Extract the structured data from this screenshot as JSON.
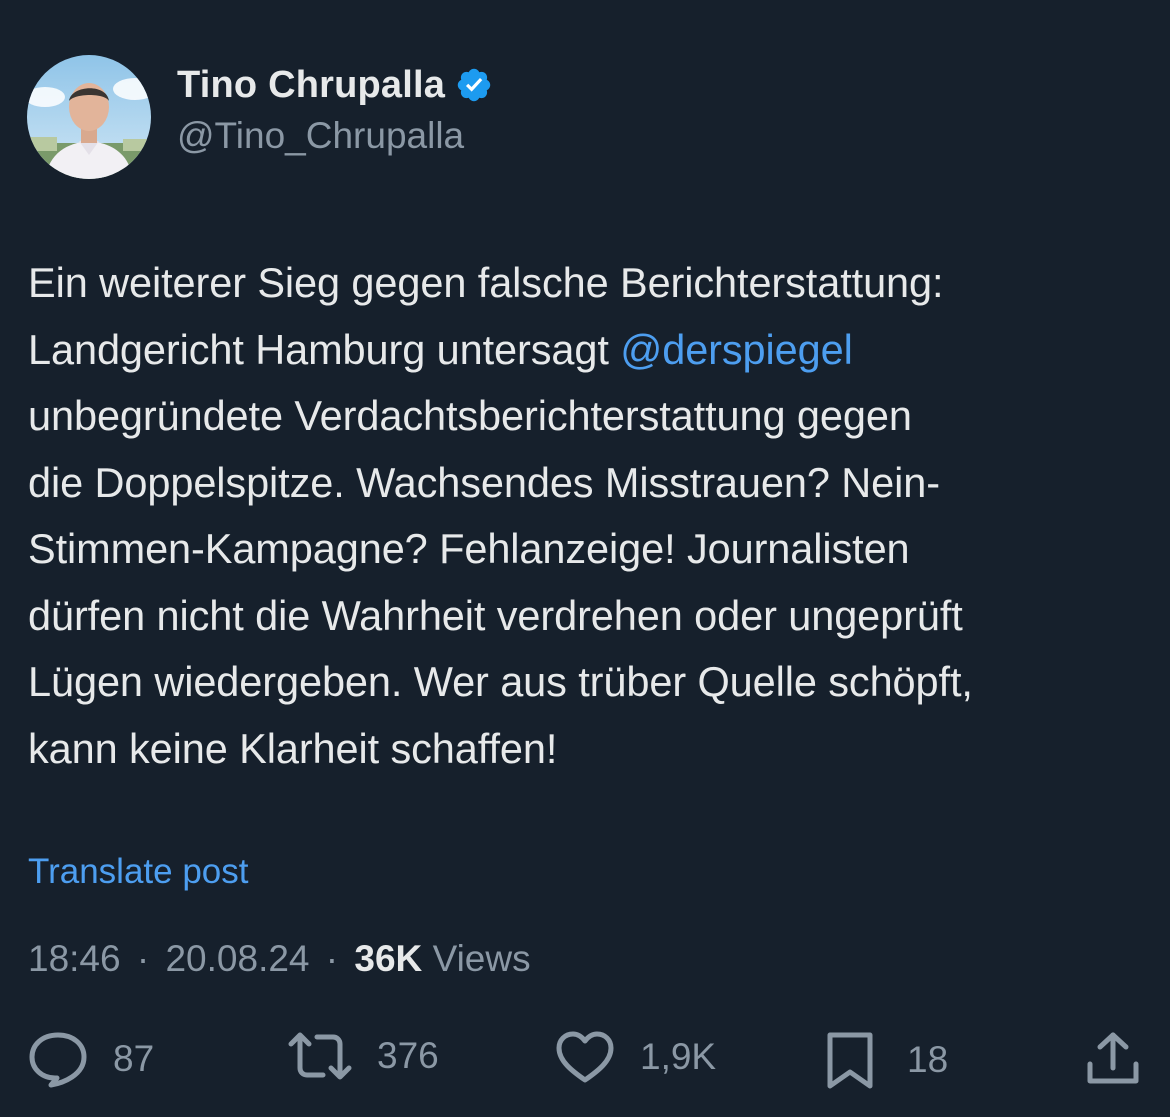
{
  "author": {
    "display_name": "Tino Chrupalla",
    "handle": "@Tino_Chrupalla",
    "verified": true
  },
  "post": {
    "lines": [
      [
        {
          "text": "Ein weiterer Sieg gegen falsche Berichterstattung:",
          "mention": false
        }
      ],
      [
        {
          "text": "Landgericht Hamburg untersagt ",
          "mention": false
        },
        {
          "text": "@derspiegel",
          "mention": true
        }
      ],
      [
        {
          "text": "unbegründete Verdachtsberichterstattung gegen",
          "mention": false
        }
      ],
      [
        {
          "text": "die Doppelspitze. Wachsendes Misstrauen? Nein-",
          "mention": false
        }
      ],
      [
        {
          "text": "Stimmen-Kampagne? Fehlanzeige! Journalisten",
          "mention": false
        }
      ],
      [
        {
          "text": "dürfen nicht die Wahrheit verdrehen oder ungeprüft",
          "mention": false
        }
      ],
      [
        {
          "text": "Lügen wiedergeben. Wer aus trüber Quelle schöpft,",
          "mention": false
        }
      ],
      [
        {
          "text": "kann keine Klarheit schaffen!",
          "mention": false
        }
      ]
    ],
    "translate_label": "Translate post"
  },
  "meta": {
    "time": "18:46",
    "separator": "·",
    "date": "20.08.24",
    "views_count": "36K",
    "views_label": "Views"
  },
  "actions": {
    "replies": "87",
    "reposts": "376",
    "likes": "1,9K",
    "bookmarks": "18"
  },
  "icons": [
    "verified-badge-icon",
    "reply-icon",
    "repost-icon",
    "like-icon",
    "bookmark-icon",
    "share-icon"
  ],
  "colors": {
    "background": "#16202c",
    "text_primary": "#e7e9ea",
    "text_secondary": "#8b98a5",
    "link": "#4d9ef0",
    "verified": "#1d9bf0"
  }
}
